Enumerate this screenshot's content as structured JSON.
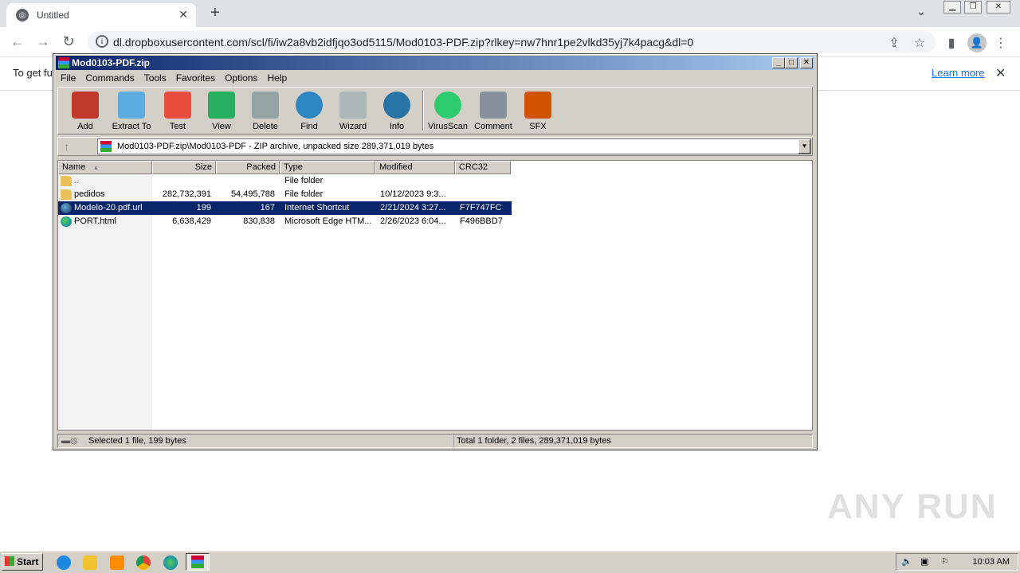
{
  "browser": {
    "tab_title": "Untitled",
    "url": "dl.dropboxusercontent.com/scl/fi/iw2a8vb2idfjqo3od5115/Mod0103-PDF.zip?rlkey=nw7hnr1pe2vlkd35yj7k4pacg&dl=0",
    "info_text": "To get fu",
    "learn_more": "Learn more",
    "profile_letter": "👤"
  },
  "winrar": {
    "title": "Mod0103-PDF.zip",
    "menu": [
      "File",
      "Commands",
      "Tools",
      "Favorites",
      "Options",
      "Help"
    ],
    "tools": [
      {
        "label": "Add",
        "color": "#c0392b"
      },
      {
        "label": "Extract To",
        "color": "#5dade2"
      },
      {
        "label": "Test",
        "color": "#e74c3c"
      },
      {
        "label": "View",
        "color": "#27ae60"
      },
      {
        "label": "Delete",
        "color": "#95a5a6"
      },
      {
        "label": "Find",
        "color": "#2e86c1"
      },
      {
        "label": "Wizard",
        "color": "#aab7b8"
      },
      {
        "label": "Info",
        "color": "#2874a6"
      },
      {
        "label": "VirusScan",
        "color": "#2ecc71"
      },
      {
        "label": "Comment",
        "color": "#85929e"
      },
      {
        "label": "SFX",
        "color": "#d35400"
      }
    ],
    "address": "Mod0103-PDF.zip\\Mod0103-PDF - ZIP archive, unpacked size 289,371,019 bytes",
    "columns": [
      "Name",
      "Size",
      "Packed",
      "Type",
      "Modified",
      "CRC32"
    ],
    "rows": [
      {
        "name": "..",
        "size": "",
        "packed": "",
        "type": "File folder",
        "modified": "",
        "crc": "",
        "icon": "folder"
      },
      {
        "name": "pedidos",
        "size": "282,732,391",
        "packed": "54,495,788",
        "type": "File folder",
        "modified": "10/12/2023 9:3...",
        "crc": "",
        "icon": "folder"
      },
      {
        "name": "Modelo-20.pdf.url",
        "size": "199",
        "packed": "167",
        "type": "Internet Shortcut",
        "modified": "2/21/2024 3:27...",
        "crc": "F7F747FC",
        "icon": "globe"
      },
      {
        "name": "PORT.html",
        "size": "6,638,429",
        "packed": "830,838",
        "type": "Microsoft Edge HTM...",
        "modified": "2/26/2023 6:04...",
        "crc": "F496BBD7",
        "icon": "edge"
      }
    ],
    "status_left": "Selected 1 file, 199 bytes",
    "status_right": "Total 1 folder, 2 files, 289,371,019 bytes"
  },
  "watermark": "ANY RUN",
  "taskbar": {
    "start": "Start",
    "clock": "10:03 AM"
  }
}
